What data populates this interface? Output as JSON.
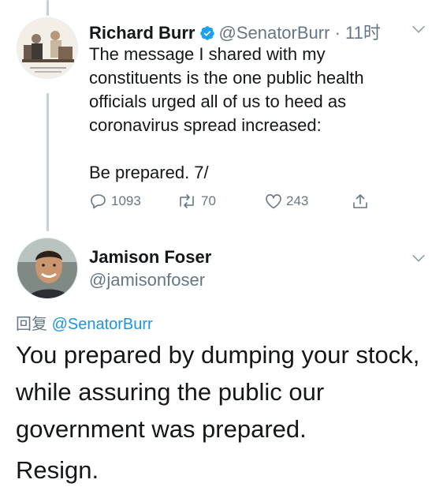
{
  "tweet": {
    "author_name": "Richard Burr",
    "author_handle": "@SenatorBurr",
    "separator": "·",
    "timestamp": "11时",
    "text": "The message I shared with my\nconstituents is the one public health\nofficials urged all of us to heed as\ncoronavirus spread increased:\n\nBe prepared. 7/",
    "reply_count": "1093",
    "retweet_count": "70",
    "like_count": "243"
  },
  "reply": {
    "author_name": "Jamison Foser",
    "author_handle": "@jamisonfoser",
    "reply_prefix": "回复",
    "reply_to": "@SenatorBurr",
    "text": "You prepared by dumping your stock, while assuring the public our government was prepared.",
    "text2": "Resign."
  },
  "colors": {
    "accent": "#1b95e0",
    "secondary_text": "#657786",
    "thread_line": "#c4cfd6"
  }
}
